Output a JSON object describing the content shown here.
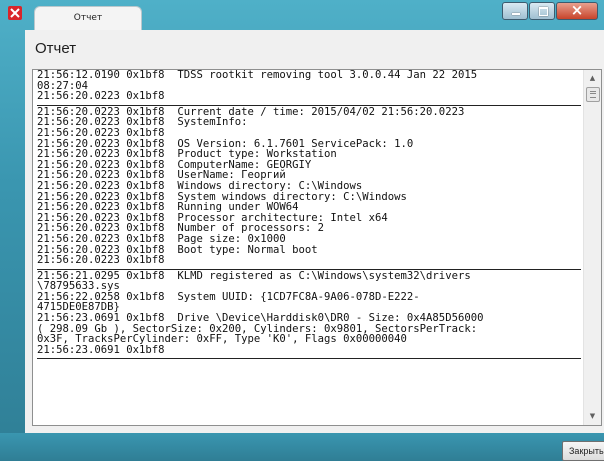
{
  "window": {
    "tab_title": "Отчет",
    "heading": "Отчет",
    "buttons": {
      "minimize": "minimize",
      "maximize": "maximize",
      "close": "close"
    }
  },
  "log": {
    "lines": [
      "21:56:12.0190 0x1bf8  TDSS rootkit removing tool 3.0.0.44 Jan 22 2015",
      "08:27:04",
      "21:56:20.0223 0x1bf8",
      "---",
      "21:56:20.0223 0x1bf8  Current date / time: 2015/04/02 21:56:20.0223",
      "21:56:20.0223 0x1bf8  SystemInfo:",
      "21:56:20.0223 0x1bf8",
      "21:56:20.0223 0x1bf8  OS Version: 6.1.7601 ServicePack: 1.0",
      "21:56:20.0223 0x1bf8  Product type: Workstation",
      "21:56:20.0223 0x1bf8  ComputerName: GEORGIY",
      "21:56:20.0223 0x1bf8  UserName: Георгий",
      "21:56:20.0223 0x1bf8  Windows directory: C:\\Windows",
      "21:56:20.0223 0x1bf8  System windows directory: C:\\Windows",
      "21:56:20.0223 0x1bf8  Running under WOW64",
      "21:56:20.0223 0x1bf8  Processor architecture: Intel x64",
      "21:56:20.0223 0x1bf8  Number of processors: 2",
      "21:56:20.0223 0x1bf8  Page size: 0x1000",
      "21:56:20.0223 0x1bf8  Boot type: Normal boot",
      "21:56:20.0223 0x1bf8",
      "---",
      "21:56:21.0295 0x1bf8  KLMD registered as C:\\Windows\\system32\\drivers",
      "\\78795633.sys",
      "21:56:22.0258 0x1bf8  System UUID: {1CD7FC8A-9A06-078D-E222-",
      "4715DE0E87DB}",
      "21:56:23.0691 0x1bf8  Drive \\Device\\Harddisk0\\DR0 - Size: 0x4A85D56000",
      "( 298.09 Gb ), SectorSize: 0x200, Cylinders: 0x9801, SectorsPerTrack:",
      "0x3F, TracksPerCylinder: 0xFF, Type 'K0', Flags 0x00000040",
      "21:56:23.0691 0x1bf8",
      "---"
    ]
  },
  "footer": {
    "close_label": "Закрыть"
  }
}
